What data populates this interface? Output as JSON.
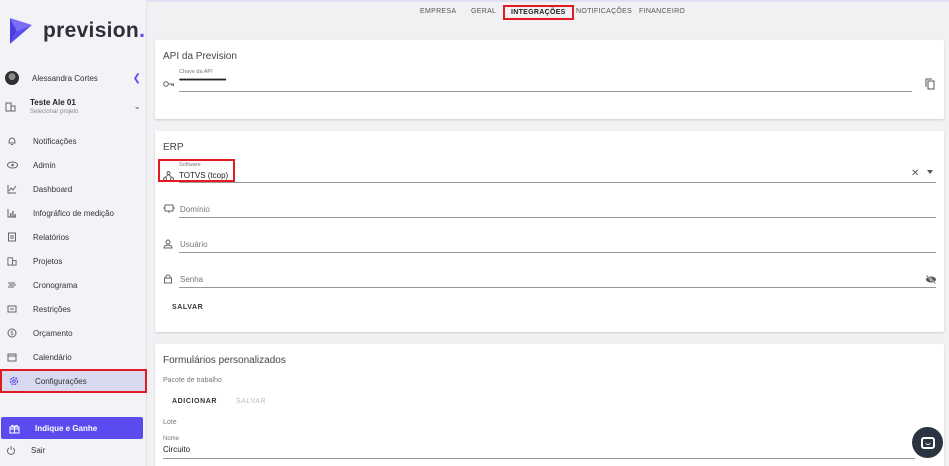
{
  "brand": {
    "logo_text": "prevision",
    "logo_dot": ".",
    "accent": "#5b4cf0",
    "highlight": "#e11b22"
  },
  "sidebar": {
    "user_name": "Alessandra Cortes",
    "project_title": "Teste Ale 01",
    "project_sub": "Selecionar projeto",
    "items": [
      {
        "label": "Notificações",
        "icon": "bell-icon"
      },
      {
        "label": "Admin",
        "icon": "eye-icon"
      },
      {
        "label": "Dashboard",
        "icon": "line-chart-icon"
      },
      {
        "label": "Infográfico de medição",
        "icon": "bar-chart-icon"
      },
      {
        "label": "Relatórios",
        "icon": "report-icon"
      },
      {
        "label": "Projetos",
        "icon": "building-icon"
      },
      {
        "label": "Cronograma",
        "icon": "schedule-icon"
      },
      {
        "label": "Restrições",
        "icon": "restriction-icon"
      },
      {
        "label": "Orçamento",
        "icon": "dollar-icon"
      },
      {
        "label": "Calendário",
        "icon": "calendar-icon"
      },
      {
        "label": "Configurações",
        "icon": "gear-icon"
      }
    ],
    "indique_label": "Indique e Ganhe",
    "sair_label": "Sair"
  },
  "tabs": [
    "EMPRESA",
    "GERAL",
    "INTEGRAÇÕES",
    "NOTIFICAÇÕES",
    "FINANCEIRO"
  ],
  "api_card": {
    "title": "API da Prevision",
    "key_label": "Chave da API",
    "key_value": "••••••••••••••••••••••••••••••••"
  },
  "erp_card": {
    "title": "ERP",
    "software_label": "Software",
    "software_value": "TOTVS (tcop)",
    "dominio_placeholder": "Domínio",
    "usuario_placeholder": "Usuário",
    "senha_placeholder": "Senha",
    "save_label": "SALVAR"
  },
  "forms_card": {
    "title": "Formulários personalizados",
    "pacote_label": "Pacote de trabalho",
    "add_label": "ADICIONAR",
    "save_label": "SALVAR",
    "lote_label": "Lote",
    "nome_label": "Nome",
    "nome_value": "Circuito"
  }
}
